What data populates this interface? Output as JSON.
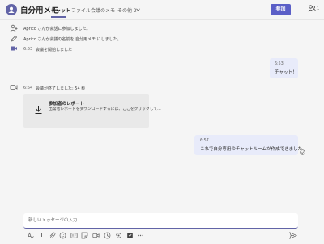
{
  "header": {
    "title": "自分用メモ",
    "tabs": [
      {
        "label": "チャット",
        "active": true
      },
      {
        "label": "ファイル",
        "active": false
      },
      {
        "label": "会議のメモ",
        "active": false
      },
      {
        "label": "その他 2",
        "active": false
      }
    ],
    "join_label": "参加",
    "people_count": "1",
    "accent_color": "#6264a7",
    "icons": [
      "avatar-icon",
      "chevron-down-icon",
      "people-icon"
    ]
  },
  "messages": {
    "system": [
      {
        "icon": "person-add-icon",
        "text": "Aprico さんが会話に参加しました。"
      },
      {
        "icon": "pencil-icon",
        "text": "Aprico さんが会議の名前を 自分用メモ にしました。"
      },
      {
        "icon": "video-icon",
        "time": "6:53",
        "text": "会議を開始しました"
      }
    ],
    "bubble1": {
      "time": "6:53",
      "text": "チャット！"
    },
    "meeting_end": {
      "icon": "video-icon",
      "time": "6:54",
      "text": "会議が終了しました: 54 秒"
    },
    "report_card": {
      "icon": "download-icon",
      "title": "参加者のレポート",
      "description": "出席者レポートをダウンロードするには、ここをクリックして..."
    },
    "bubble2": {
      "time": "6:57",
      "text": "これで自分専用のチャットルームが作成できました",
      "status_icon": "sent-check-icon"
    }
  },
  "compose": {
    "placeholder": "新しいメッセージの入力",
    "value": "",
    "toolbar_icons": [
      "format-icon",
      "priority-icon",
      "attach-icon",
      "emoji-icon",
      "gif-icon",
      "sticker-icon",
      "meet-now-icon",
      "send-later-icon",
      "loop-icon",
      "praise-icon",
      "more-icon"
    ],
    "send_icon": "send-icon"
  }
}
